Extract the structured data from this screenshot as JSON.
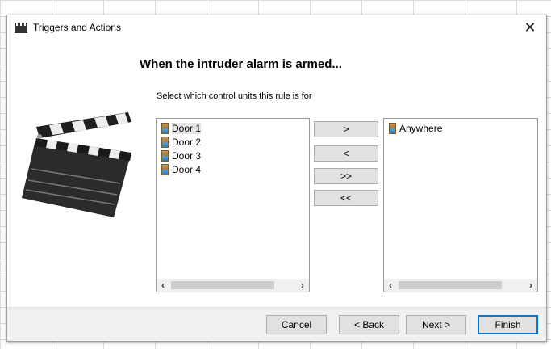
{
  "dialog": {
    "title": "Triggers and Actions",
    "close_label": "✕",
    "heading": "When the intruder alarm is armed...",
    "subheading": "Select which control units this rule is for"
  },
  "left_list": {
    "items": [
      {
        "label": "Door 1",
        "selected": true
      },
      {
        "label": "Door 2",
        "selected": false
      },
      {
        "label": "Door 3",
        "selected": false
      },
      {
        "label": "Door 4",
        "selected": false
      }
    ]
  },
  "right_list": {
    "items": [
      {
        "label": "Anywhere"
      }
    ]
  },
  "movers": {
    "add_one": ">",
    "remove_one": "<",
    "add_all": ">>",
    "remove_all": "<<"
  },
  "footer": {
    "cancel": "Cancel",
    "back": "< Back",
    "next": "Next >",
    "finish": "Finish"
  },
  "icons": {
    "title": "clapperboard-icon",
    "list_item": "door-icon",
    "illustration": "clapperboard-icon"
  }
}
